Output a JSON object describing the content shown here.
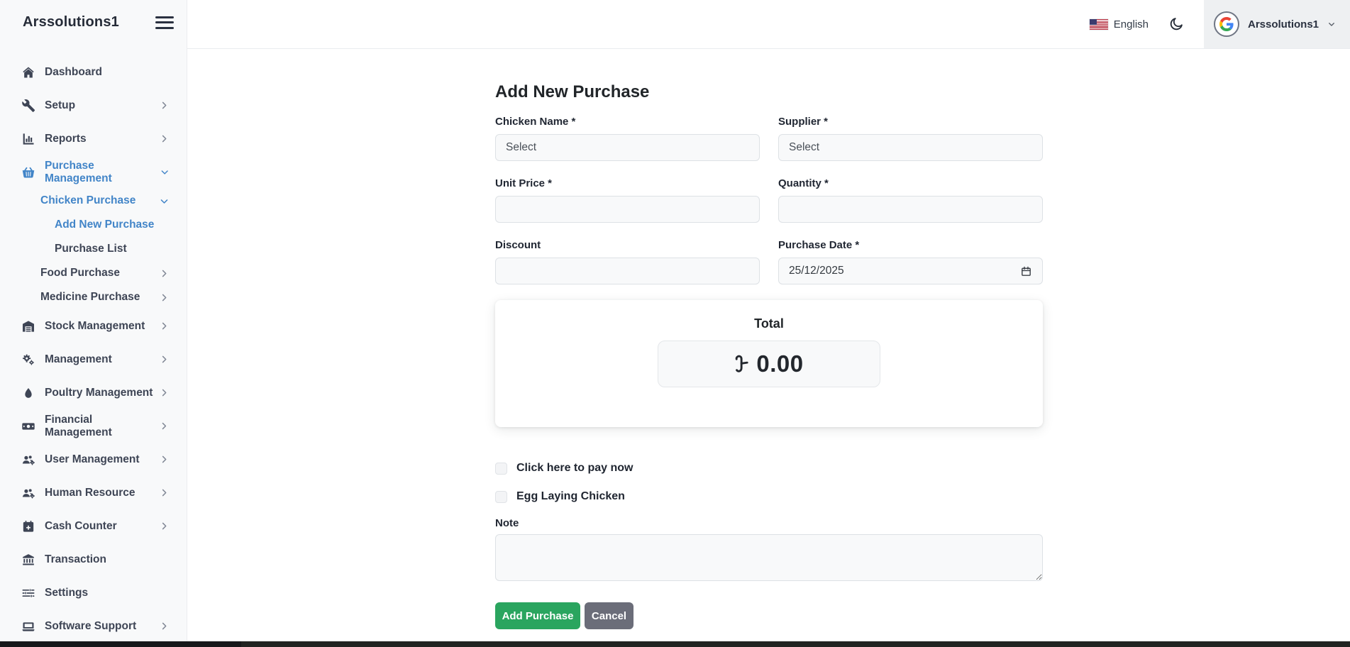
{
  "brand": {
    "title": "Arssolutions1"
  },
  "topbar": {
    "language": {
      "label": "English",
      "flag_icon": "us-flag-icon"
    },
    "theme_toggle_icon": "moon-icon",
    "user": {
      "name": "Arssolutions1",
      "avatar_icon": "google-g-icon"
    }
  },
  "sidebar": {
    "items": [
      {
        "label": "Dashboard",
        "icon": "home-icon",
        "level": 0,
        "active": false,
        "chevron": null
      },
      {
        "label": "Setup",
        "icon": "wrench-icon",
        "level": 0,
        "active": false,
        "chevron": "right"
      },
      {
        "label": "Reports",
        "icon": "bar-chart-icon",
        "level": 0,
        "active": false,
        "chevron": "right"
      },
      {
        "label": "Purchase Management",
        "icon": "basket-icon",
        "level": 0,
        "active": true,
        "chevron": "down"
      },
      {
        "label": "Chicken Purchase",
        "icon": null,
        "level": 1,
        "active": true,
        "chevron": "down"
      },
      {
        "label": "Add New Purchase",
        "icon": null,
        "level": 2,
        "active": true,
        "chevron": null
      },
      {
        "label": "Purchase List",
        "icon": null,
        "level": 2,
        "active": false,
        "chevron": null
      },
      {
        "label": "Food Purchase",
        "icon": null,
        "level": 1,
        "active": false,
        "chevron": "right"
      },
      {
        "label": "Medicine Purchase",
        "icon": null,
        "level": 1,
        "active": false,
        "chevron": "right"
      },
      {
        "label": "Stock Management",
        "icon": "warehouse-icon",
        "level": 0,
        "active": false,
        "chevron": "right"
      },
      {
        "label": "Management",
        "icon": "gears-icon",
        "level": 0,
        "active": false,
        "chevron": "right"
      },
      {
        "label": "Poultry Management",
        "icon": "egg-icon",
        "level": 0,
        "active": false,
        "chevron": "right"
      },
      {
        "label": "Financial Management",
        "icon": "banknote-icon",
        "level": 0,
        "active": false,
        "chevron": "right"
      },
      {
        "label": "User Management",
        "icon": "users-gear-icon",
        "level": 0,
        "active": false,
        "chevron": "right"
      },
      {
        "label": "Human Resource",
        "icon": "users-gear-icon",
        "level": 0,
        "active": false,
        "chevron": "right"
      },
      {
        "label": "Cash Counter",
        "icon": "calendar-plus-icon",
        "level": 0,
        "active": false,
        "chevron": "right"
      },
      {
        "label": "Transaction",
        "icon": "bank-icon",
        "level": 0,
        "active": false,
        "chevron": null
      },
      {
        "label": "Settings",
        "icon": "sliders-icon",
        "level": 0,
        "active": false,
        "chevron": null
      },
      {
        "label": "Software Support",
        "icon": "laptop-icon",
        "level": 0,
        "active": false,
        "chevron": "right"
      }
    ]
  },
  "page": {
    "title": "Add New Purchase",
    "form": {
      "chicken_name": {
        "label": "Chicken Name *",
        "placeholder": "Select"
      },
      "supplier": {
        "label": "Supplier *",
        "placeholder": "Select"
      },
      "unit_price": {
        "label": "Unit Price *",
        "value": ""
      },
      "quantity": {
        "label": "Quantity *",
        "value": ""
      },
      "discount": {
        "label": "Discount",
        "value": ""
      },
      "purchase_date": {
        "label": "Purchase Date *",
        "value": "25/12/2025",
        "icon": "calendar-icon"
      }
    },
    "total": {
      "label": "Total",
      "currency": "৳",
      "amount": "0.00"
    },
    "checkboxes": [
      {
        "label": "Click here to pay now",
        "checked": false
      },
      {
        "label": "Egg Laying Chicken",
        "checked": false
      }
    ],
    "note": {
      "label": "Note",
      "value": ""
    },
    "buttons": {
      "submit": "Add Purchase",
      "cancel": "Cancel"
    }
  },
  "colors": {
    "accent_blue": "#4285c8",
    "submit_green": "#2aa55f",
    "cancel_gray": "#6b6d79",
    "sidebar_bg": "#f8f9fa",
    "userblock_bg": "#eef0f2"
  }
}
